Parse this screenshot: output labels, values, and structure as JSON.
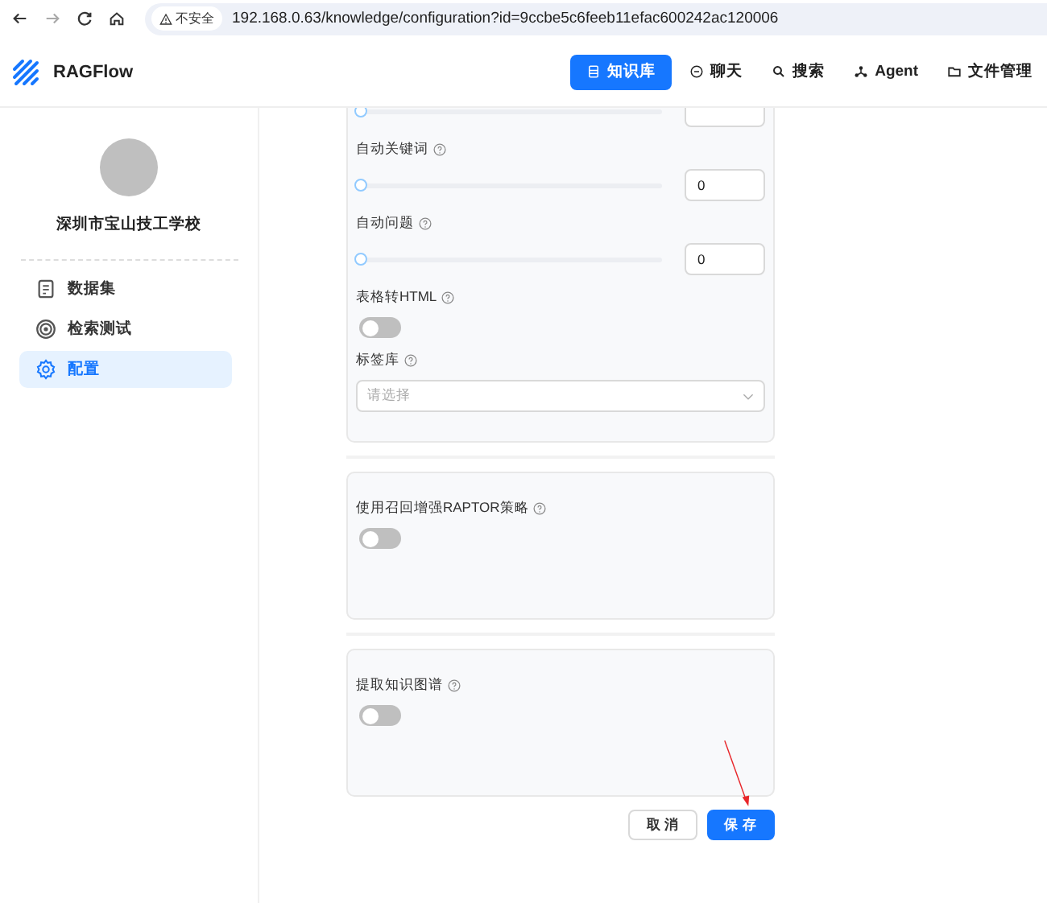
{
  "browser": {
    "security": "不安全",
    "url": "192.168.0.63/knowledge/configuration?id=9ccbe5c6feeb11efac600242ac120006"
  },
  "app": {
    "name": "RAGFlow"
  },
  "nav": [
    {
      "label": "知识库",
      "kind": "database",
      "selected": true
    },
    {
      "label": "聊天",
      "kind": "chat",
      "selected": false
    },
    {
      "label": "搜索",
      "kind": "search",
      "selected": false
    },
    {
      "label": "Agent",
      "kind": "agent",
      "selected": false
    },
    {
      "label": "文件管理",
      "kind": "folder",
      "selected": false
    }
  ],
  "sidebar": {
    "name": "深圳市宝山技工学校",
    "items": [
      {
        "label": "数据集",
        "kind": "document",
        "selected": false
      },
      {
        "label": "检索测试",
        "kind": "target",
        "selected": false
      },
      {
        "label": "配置",
        "kind": "settings",
        "selected": true
      }
    ]
  },
  "sections": [
    {
      "fields": [
        {
          "kind": "slider",
          "level": 0
        },
        {
          "kind": "slider",
          "label": "自动关键词",
          "level": 0,
          "value": "0"
        },
        {
          "kind": "slider",
          "label": "自动问题",
          "level": 0,
          "value": "0"
        },
        {
          "kind": "toggle",
          "label": "表格转HTML",
          "on": false
        },
        {
          "kind": "select",
          "label": "标签库",
          "placeholder": "请选择"
        }
      ]
    },
    {
      "fields": [
        {
          "kind": "toggle",
          "label": "使用召回增强RAPTOR策略",
          "on": false
        }
      ]
    },
    {
      "fields": [
        {
          "kind": "toggle",
          "label": "提取知识图谱",
          "on": false
        }
      ]
    }
  ],
  "buttons": [
    {
      "label": "取 消",
      "kind": "secondary"
    },
    {
      "label": "保 存",
      "kind": "primary"
    }
  ]
}
